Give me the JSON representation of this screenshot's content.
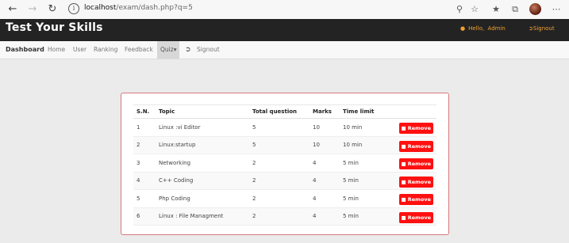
{
  "browser": {
    "url_host": "localhost",
    "url_path": "/exam/dash.php?q=5"
  },
  "header": {
    "brand": "Test Your Skills",
    "greeting": "Hello,",
    "user": "Admin",
    "signout": "Signout"
  },
  "nav": {
    "dashboard": "Dashboard",
    "home": "Home",
    "user": "User",
    "ranking": "Ranking",
    "feedback": "Feedback",
    "quiz": "Quiz",
    "signout": "Signout"
  },
  "table": {
    "headers": [
      "S.N.",
      "Topic",
      "Total question",
      "Marks",
      "Time limit"
    ],
    "remove_label": "Remove",
    "rows": [
      {
        "sn": "1",
        "topic": "Linux :vi Editor",
        "total": "5",
        "marks": "10",
        "time": "10 min"
      },
      {
        "sn": "2",
        "topic": "Linux:startup",
        "total": "5",
        "marks": "10",
        "time": "10 min"
      },
      {
        "sn": "3",
        "topic": "Networking",
        "total": "2",
        "marks": "4",
        "time": "5 min"
      },
      {
        "sn": "4",
        "topic": "C++ Coding",
        "total": "2",
        "marks": "4",
        "time": "5 min"
      },
      {
        "sn": "5",
        "topic": "Php Coding",
        "total": "2",
        "marks": "4",
        "time": "5 min"
      },
      {
        "sn": "6",
        "topic": "Linux : File Managment",
        "total": "2",
        "marks": "4",
        "time": "5 min"
      }
    ]
  }
}
